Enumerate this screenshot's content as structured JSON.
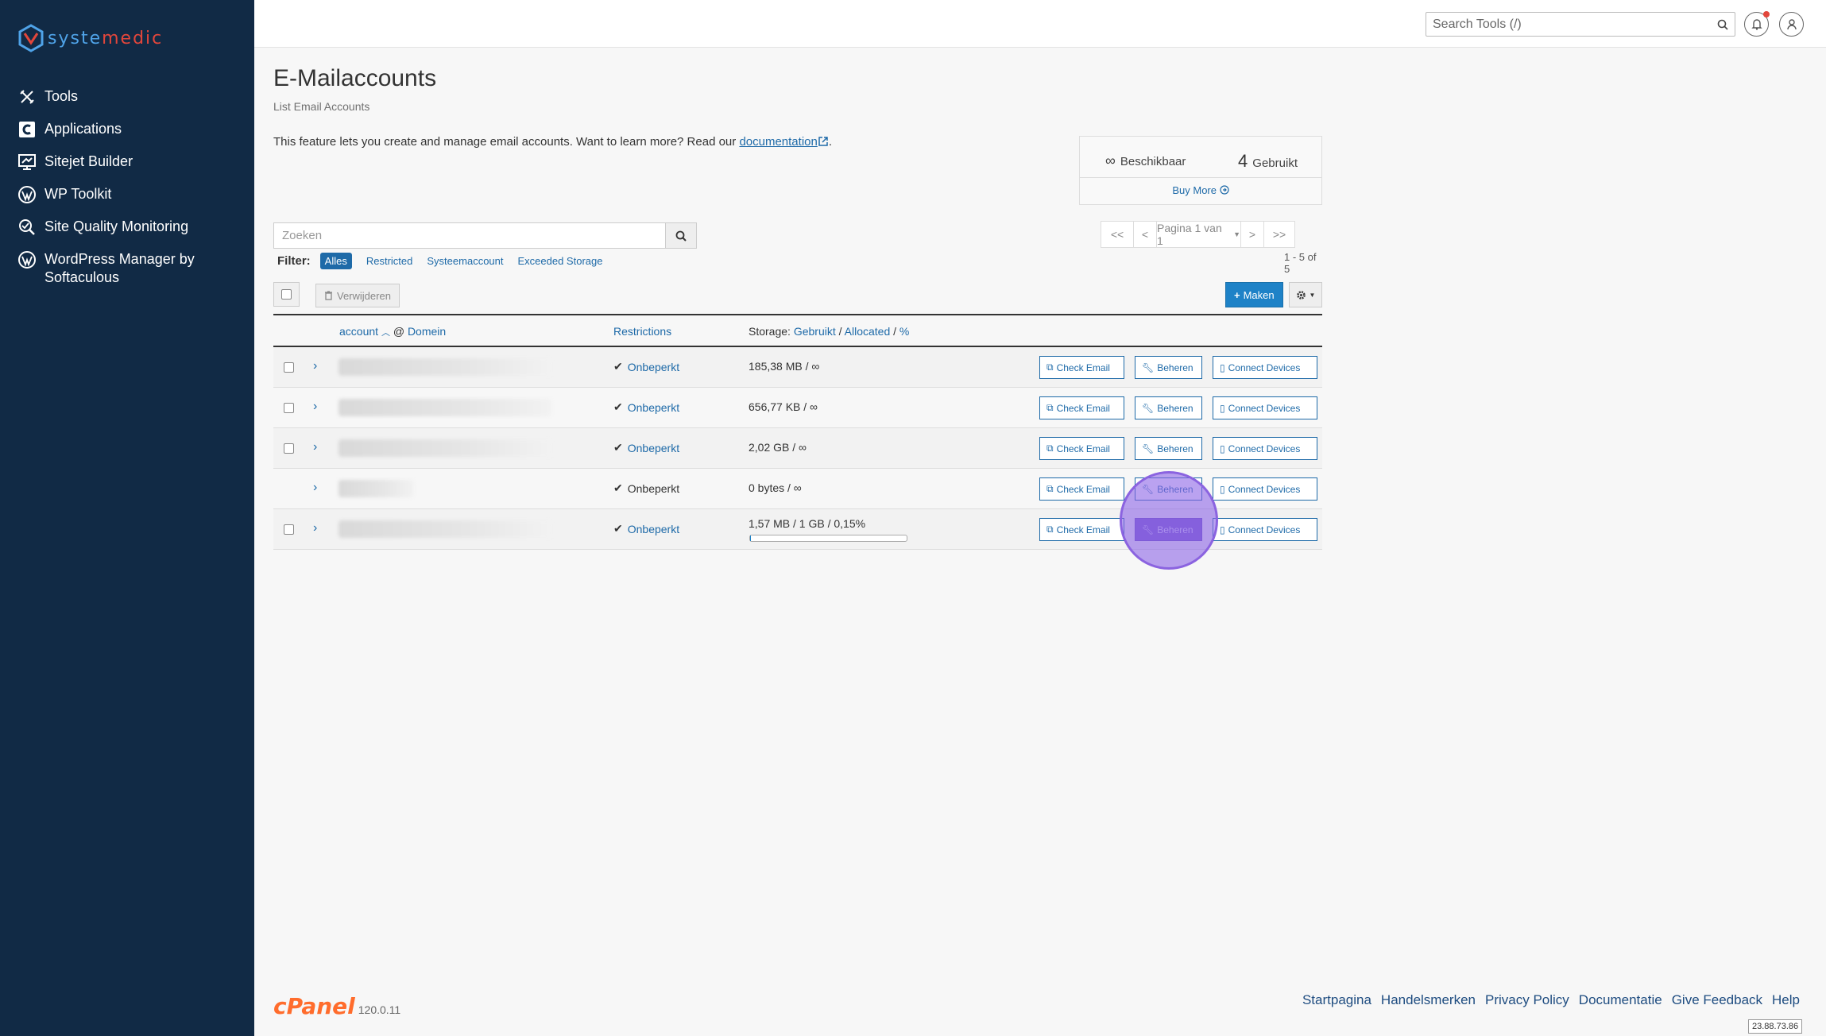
{
  "brand": {
    "logo_text_a": "syste",
    "logo_text_b": "medic"
  },
  "sidebar": {
    "items": [
      {
        "label": "Tools",
        "icon": "tools-icon"
      },
      {
        "label": "Applications",
        "icon": "applications-icon"
      },
      {
        "label": "Sitejet Builder",
        "icon": "sitejet-icon"
      },
      {
        "label": "WP Toolkit",
        "icon": "wordpress-icon"
      },
      {
        "label": "Site Quality Monitoring",
        "icon": "site-quality-icon"
      },
      {
        "label": "WordPress Manager by",
        "label2": "Softaculous",
        "icon": "wordpress-icon"
      }
    ]
  },
  "topbar": {
    "search_placeholder": "Search Tools (/)"
  },
  "page": {
    "title": "E-Mailaccounts",
    "subtitle": "List Email Accounts",
    "intro": "This feature lets you create and manage email accounts. Want to learn more? Read our",
    "intro_link": "documentation",
    "intro_end": "."
  },
  "stats": {
    "available_symbol": "∞",
    "available_label": "Beschikbaar",
    "used_count": "4",
    "used_label": "Gebruikt",
    "buy_more": "Buy More"
  },
  "search": {
    "placeholder": "Zoeken"
  },
  "pager": {
    "first": "<<",
    "prev": "<",
    "page": "Pagina 1 van 1",
    "next": ">",
    "last": ">>",
    "range": "1 - 5 of 5"
  },
  "filter": {
    "label": "Filter:",
    "options": [
      "Alles",
      "Restricted",
      "Systeemaccount",
      "Exceeded Storage"
    ]
  },
  "toolbar": {
    "delete": "Verwijderen",
    "create": "Maken"
  },
  "table": {
    "headers": {
      "account": "account",
      "at": "@",
      "domain": "Domein",
      "restrictions": "Restrictions",
      "storage": "Storage:",
      "used": "Gebruikt",
      "sep1": "/",
      "allocated": "Allocated",
      "sep2": "/",
      "pct": "%"
    },
    "rows": [
      {
        "restriction": "Onbeperkt",
        "storage": "185,38 MB / ∞"
      },
      {
        "restriction": "Onbeperkt",
        "storage": "656,77 KB / ∞"
      },
      {
        "restriction": "Onbeperkt",
        "storage": "2,02 GB / ∞"
      },
      {
        "restriction": "Onbeperkt",
        "storage": "0 bytes / ∞"
      },
      {
        "restriction": "Onbeperkt",
        "storage": "1,57 MB / 1 GB / 0,15%",
        "usage_fraction": 0.0015
      }
    ],
    "actions": {
      "check": "Check Email",
      "manage": "Beheren",
      "connect": "Connect Devices"
    }
  },
  "footer": {
    "logo": "cPanel",
    "version": "120.0.11",
    "links": [
      "Startpagina",
      "Handelsmerken",
      "Privacy Policy",
      "Documentatie",
      "Give Feedback",
      "Help"
    ],
    "ip": "23.88.73.86"
  },
  "colors": {
    "sidebar": "#112a45",
    "link": "#1e6aa8",
    "primary": "#1e82c7",
    "highlight": "#8b63e0",
    "cpanel": "#ff6c2c"
  }
}
